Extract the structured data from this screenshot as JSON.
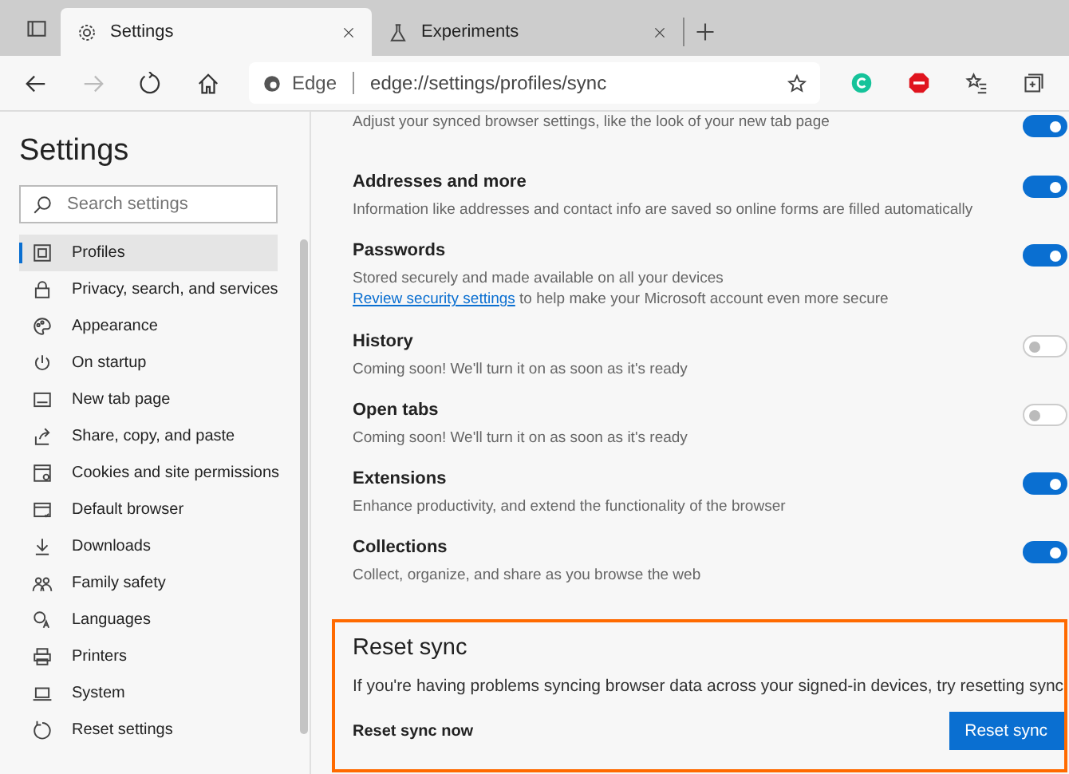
{
  "tabs": [
    {
      "label": "Settings",
      "kind": "settings",
      "selected": true
    },
    {
      "label": "Experiments",
      "kind": "experiments",
      "selected": false
    }
  ],
  "nav_buttons": [
    {
      "kind": "back",
      "disabled": false
    },
    {
      "kind": "forward",
      "disabled": true
    },
    {
      "kind": "refresh",
      "disabled": false
    },
    {
      "kind": "home",
      "disabled": false
    }
  ],
  "address_bar": {
    "site_label": "Edge",
    "url": "edge://settings/profiles/sync"
  },
  "sidebar": {
    "title": "Settings",
    "search": {
      "placeholder": "Search settings"
    },
    "items": [
      {
        "label": "Profiles",
        "selected": true
      },
      {
        "label": "Privacy, search, and services",
        "selected": false
      },
      {
        "label": "Appearance",
        "selected": false
      },
      {
        "label": "On startup",
        "selected": false
      },
      {
        "label": "New tab page",
        "selected": false
      },
      {
        "label": "Share, copy, and paste",
        "selected": false
      },
      {
        "label": "Cookies and site permissions",
        "selected": false
      },
      {
        "label": "Default browser",
        "selected": false
      },
      {
        "label": "Downloads",
        "selected": false
      },
      {
        "label": "Family safety",
        "selected": false
      },
      {
        "label": "Languages",
        "selected": false
      },
      {
        "label": "Printers",
        "selected": false
      },
      {
        "label": "System",
        "selected": false
      },
      {
        "label": "Reset settings",
        "selected": false
      }
    ]
  },
  "sync_items": [
    {
      "description": "Adjust your synced browser settings, like the look of your new tab page",
      "on": true
    },
    {
      "title": "Addresses and more",
      "description": "Information like addresses and contact info are saved so online forms are filled automatically",
      "on": true
    },
    {
      "title": "Passwords",
      "description": "Stored securely and made available on all your devices",
      "link": "Review security settings",
      "after_link": "to help make your Microsoft account even more secure",
      "on": true
    },
    {
      "title": "History",
      "description": "Coming soon! We'll turn it on as soon as it's ready",
      "on": false
    },
    {
      "title": "Open tabs",
      "description": "Coming soon! We'll turn it on as soon as it's ready",
      "on": false
    },
    {
      "title": "Extensions",
      "description": "Enhance productivity, and extend the functionality of the browser",
      "on": true
    },
    {
      "title": "Collections",
      "description": "Collect, organize, and share as you browse the web",
      "on": true
    }
  ],
  "reset_sync": {
    "title": "Reset sync",
    "description": "If you're having problems syncing browser data across your signed-in devices, try resetting sync",
    "action_label": "Reset sync now",
    "button": "Reset sync"
  }
}
